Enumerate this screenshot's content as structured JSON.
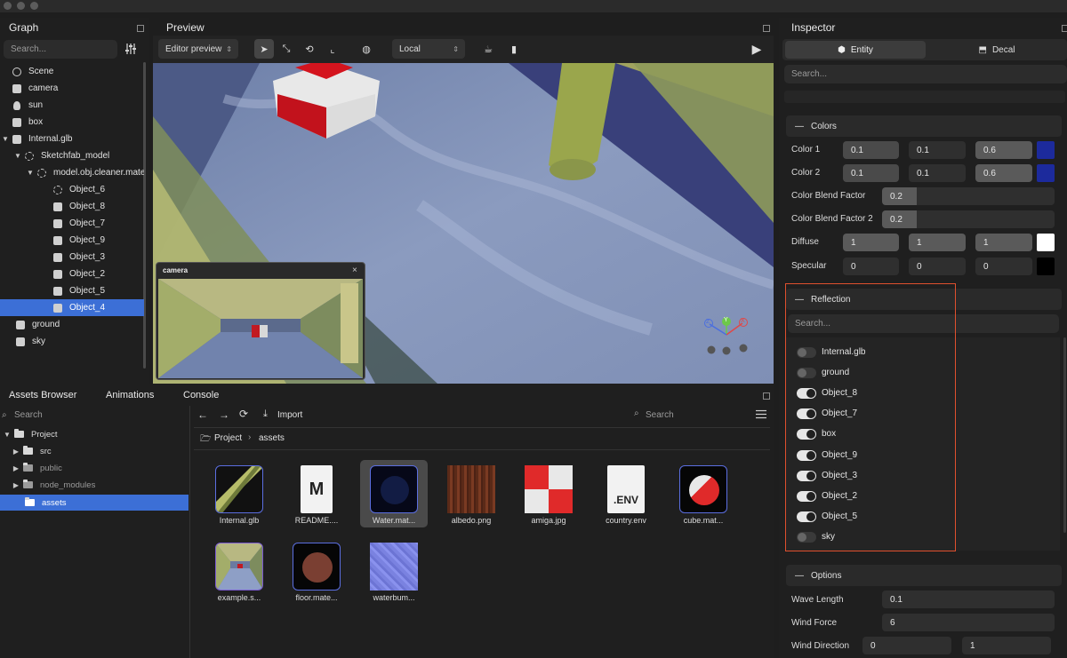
{
  "graph": {
    "title": "Graph",
    "search_placeholder": "Search...",
    "items": [
      {
        "label": "Scene",
        "icon": "scene-icon"
      },
      {
        "label": "camera",
        "icon": "camera-icon"
      },
      {
        "label": "sun",
        "icon": "light-bulb-icon"
      },
      {
        "label": "box",
        "icon": "cube-icon"
      },
      {
        "label": "Internal.glb",
        "icon": "cube-icon"
      },
      {
        "label": "Sketchfab_model",
        "icon": "wireframe-icon"
      },
      {
        "label": "model.obj.cleaner.materialmerger.gles",
        "icon": "wireframe-icon"
      },
      {
        "label": "Object_6",
        "icon": "wireframe-icon"
      },
      {
        "label": "Object_8",
        "icon": "cube-icon"
      },
      {
        "label": "Object_7",
        "icon": "cube-icon"
      },
      {
        "label": "Object_9",
        "icon": "cube-icon"
      },
      {
        "label": "Object_3",
        "icon": "cube-icon"
      },
      {
        "label": "Object_2",
        "icon": "cube-icon"
      },
      {
        "label": "Object_5",
        "icon": "cube-icon"
      },
      {
        "label": "Object_4",
        "icon": "cube-icon"
      },
      {
        "label": "ground",
        "icon": "cube-icon"
      },
      {
        "label": "sky",
        "icon": "cube-icon"
      }
    ]
  },
  "preview": {
    "title": "Preview",
    "mode": "Editor preview",
    "space": "Local",
    "camera_window_title": "camera",
    "gizmo": {
      "x": "X",
      "y": "Y",
      "z": "Z"
    }
  },
  "bottom_tabs": {
    "assets": "Assets Browser",
    "animations": "Animations",
    "console": "Console"
  },
  "file_tree": {
    "search": "Search",
    "items": [
      {
        "label": "Project"
      },
      {
        "label": "src"
      },
      {
        "label": "public"
      },
      {
        "label": "node_modules"
      },
      {
        "label": "assets"
      }
    ]
  },
  "assets_browser": {
    "import_label": "Import",
    "search_placeholder": "Search",
    "breadcrumb": [
      "Project",
      "assets"
    ],
    "assets": [
      {
        "name": "Internal.glb"
      },
      {
        "name": "README....",
        "badge": "M"
      },
      {
        "name": "Water.mat..."
      },
      {
        "name": "albedo.png"
      },
      {
        "name": "amiga.jpg"
      },
      {
        "name": "country.env",
        "badge": ".ENV"
      },
      {
        "name": "cube.mat..."
      },
      {
        "name": "example.s..."
      },
      {
        "name": "floor.mate..."
      },
      {
        "name": "waterbum..."
      }
    ]
  },
  "inspector": {
    "title": "Inspector",
    "tabs": {
      "entity": "Entity",
      "decal": "Decal"
    },
    "search_placeholder": "Search...",
    "colors": {
      "title": "Colors",
      "color1": {
        "label": "Color 1",
        "r": "0.1",
        "g": "0.1",
        "b": "0.6",
        "swatch": "#1c2a9c"
      },
      "color2": {
        "label": "Color 2",
        "r": "0.1",
        "g": "0.1",
        "b": "0.6",
        "swatch": "#1c2a9c"
      },
      "blend1": {
        "label": "Color Blend Factor",
        "value": "0.2"
      },
      "blend2": {
        "label": "Color Blend Factor 2",
        "value": "0.2"
      },
      "diffuse": {
        "label": "Diffuse",
        "r": "1",
        "g": "1",
        "b": "1",
        "swatch": "#ffffff"
      },
      "specular": {
        "label": "Specular",
        "r": "0",
        "g": "0",
        "b": "0",
        "swatch": "#000000"
      }
    },
    "reflection": {
      "title": "Reflection",
      "search_placeholder": "Search...",
      "items": [
        {
          "label": "Internal.glb",
          "on": false
        },
        {
          "label": "ground",
          "on": false
        },
        {
          "label": "Object_8",
          "on": true
        },
        {
          "label": "Object_7",
          "on": true
        },
        {
          "label": "box",
          "on": true
        },
        {
          "label": "Object_9",
          "on": true
        },
        {
          "label": "Object_3",
          "on": true
        },
        {
          "label": "Object_2",
          "on": true
        },
        {
          "label": "Object_5",
          "on": true
        },
        {
          "label": "sky",
          "on": false
        }
      ]
    },
    "options": {
      "title": "Options",
      "wave_length": {
        "label": "Wave Length",
        "value": "0.1"
      },
      "wind_force": {
        "label": "Wind Force",
        "value": "6"
      },
      "wind_direction": {
        "label": "Wind Direction",
        "x": "0",
        "y": "1"
      }
    }
  }
}
